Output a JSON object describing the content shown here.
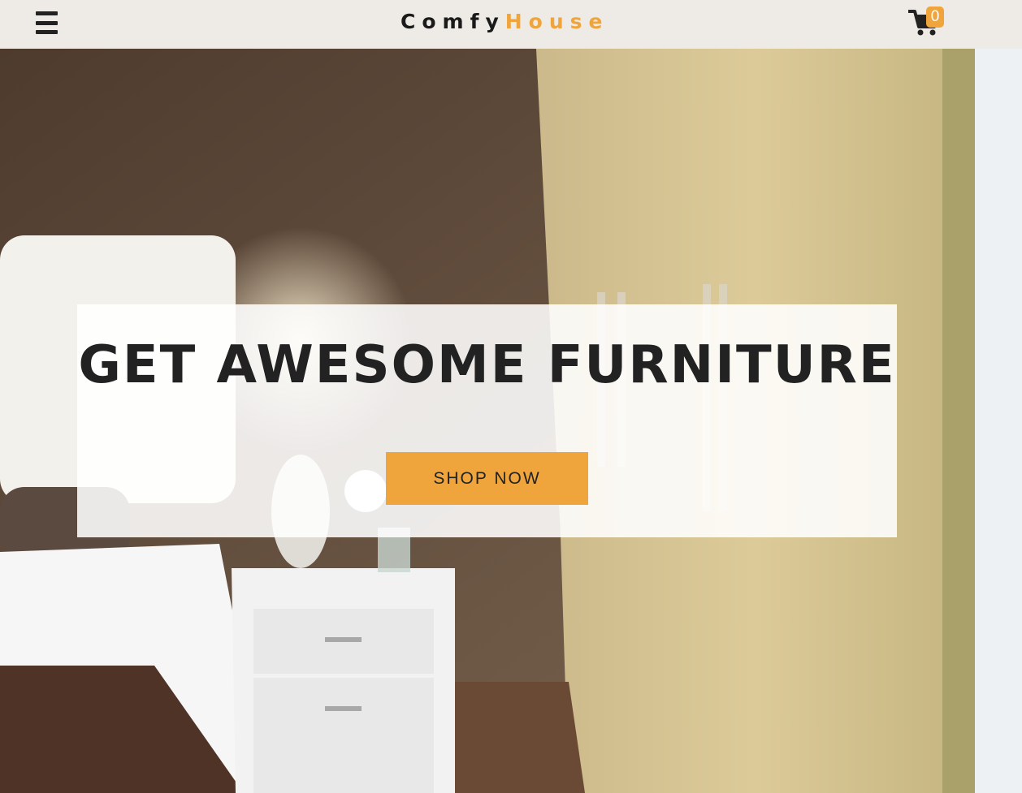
{
  "nav": {
    "menu_icon": "hamburger-menu-icon",
    "logo_part1": "Comfy",
    "logo_part2": "House",
    "cart_icon": "shopping-cart-icon",
    "cart_count": "0"
  },
  "hero": {
    "background": "bedroom-interior-photo",
    "title": "GET AWESOME FURNITURE",
    "button_label": "SHOP NOW"
  },
  "colors": {
    "accent": "#f0a53c",
    "navbar_bg": "#eeebe6",
    "text_dark": "#222222"
  }
}
